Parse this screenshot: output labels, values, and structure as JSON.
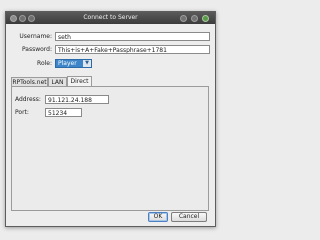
{
  "window": {
    "title": "Connect to Server"
  },
  "form": {
    "username_label": "Username:",
    "username_value": "seth",
    "password_label": "Password:",
    "password_value": "This+is+A+Fake+Passphrase+1781",
    "role_label": "Role:",
    "role_value": "Player"
  },
  "tabs": [
    {
      "label": "RPTools.net"
    },
    {
      "label": "LAN"
    },
    {
      "label": "Direct"
    }
  ],
  "direct": {
    "address_label": "Address:",
    "address_value": "91.121.24.188",
    "port_label": "Port:",
    "port_value": "51234"
  },
  "buttons": {
    "ok": "OK",
    "cancel": "Cancel"
  },
  "icons": {
    "left": [
      "window-menu-icon",
      "minimize-icon",
      "maximize-icon"
    ],
    "right": [
      "shade-icon",
      "restore-icon",
      "close-icon"
    ]
  },
  "colors": {
    "selected_role": "#3d85c8",
    "titlebar": "#4a4a4a"
  }
}
